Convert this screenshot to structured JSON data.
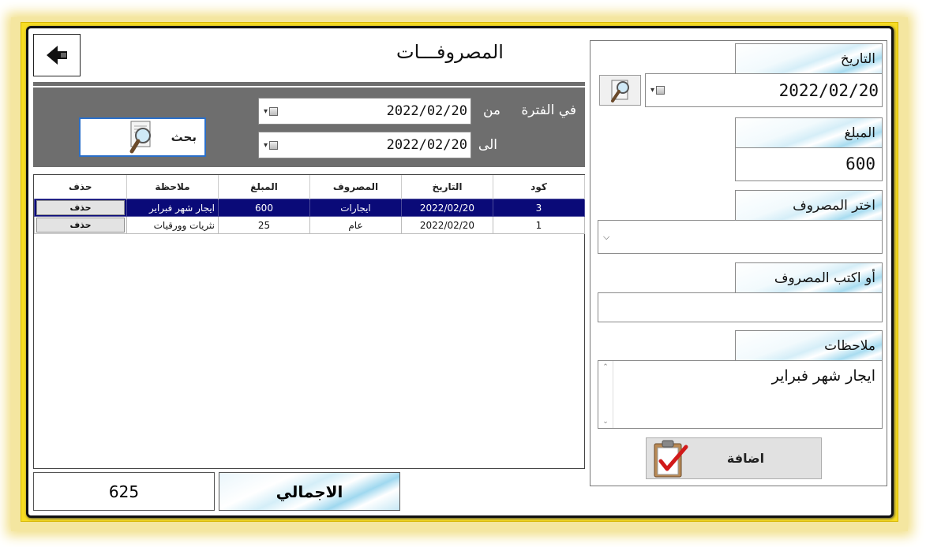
{
  "window": {
    "title": "المصروفـــات"
  },
  "filter": {
    "period_label": "في الفترة",
    "from_label": "من",
    "to_label": "الى",
    "from_date": "2022/02/20",
    "to_date": "2022/02/20",
    "search_label": "بحث"
  },
  "table": {
    "columns": [
      "كود",
      "التاريخ",
      "المصروف",
      "المبلغ",
      "ملاحظة",
      "حذف"
    ],
    "rows": [
      {
        "code": "3",
        "date": "2022/02/20",
        "expense": "ايجارات",
        "amount": "600",
        "note": "ايجار شهر فبراير",
        "delete": "حذف"
      },
      {
        "code": "1",
        "date": "2022/02/20",
        "expense": "عام",
        "amount": "25",
        "note": "نثريات وورقيات",
        "delete": "حذف"
      }
    ]
  },
  "total": {
    "label": "الاجمالي",
    "value": "625"
  },
  "form": {
    "date_label": "التاريخ",
    "date_value": "2022/02/20",
    "amount_label": "المبلغ",
    "amount_value": "600",
    "choose_label": "اختر المصروف",
    "choose_value": "",
    "write_label": "أو اكتب المصروف",
    "write_value": "",
    "notes_label": "ملاحظات",
    "notes_value": "ايجار شهر فبراير",
    "add_label": "اضافة"
  },
  "icons": {
    "back": "back-arrow-icon",
    "search": "magnifier-document-icon",
    "calendar": "calendar-search-icon",
    "add": "clipboard-check-icon"
  }
}
